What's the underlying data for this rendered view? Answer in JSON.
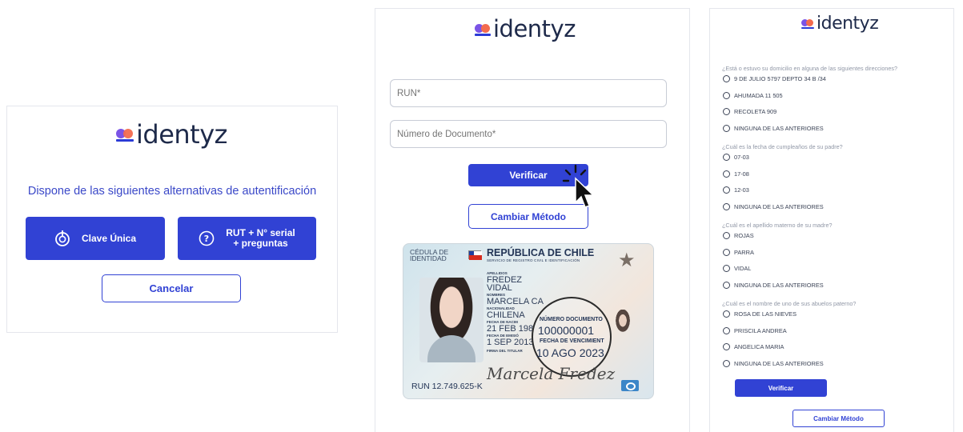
{
  "brand": {
    "name": "identyz",
    "colors": {
      "primary": "#3142d4",
      "logo_purple": "#7b54e6",
      "logo_orange": "#f36b4f",
      "text_dark": "#1e2a4a"
    }
  },
  "panel1": {
    "prompt": "Dispone de las siguientes alternativas de autentificación",
    "clave_unica_label": "Clave Única",
    "clave_unica_icon": "clave-unica-icon",
    "rut_line1": "RUT + N° serial",
    "rut_line2": "+ preguntas",
    "rut_icon": "question-circle-icon",
    "cancel_label": "Cancelar"
  },
  "panel2": {
    "run_placeholder": "RUN*",
    "doc_placeholder": "Número de Documento*",
    "verify_label": "Verificar",
    "change_method_label": "Cambiar Método",
    "id_card": {
      "header_left_1": "CÉDULA DE",
      "header_left_2": "IDENTIDAD",
      "title": "REPÚBLICA DE CHILE",
      "subtitle": "SERVICIO DE REGISTRO CIVIL E IDENTIFICACIÓN",
      "apellidos_label": "APELLIDOS",
      "apellido1": "FREDEZ",
      "apellido2": "VIDAL",
      "nombres_label": "NOMBRES",
      "nombres": "MARCELA CA",
      "nacionalidad_label": "NACIONALIDAD",
      "nacionalidad": "CHILENA",
      "fecha_nac_label": "FECHA DE NACIM",
      "fecha_nac": "21 FEB 198",
      "fecha_emision_label": "FECHA DE EMISIÓ",
      "fecha_emision": "1 SEP 2013",
      "firma_label": "FIRMA DEL TITULAR",
      "numero_documento_label": "NÚMERO DOCUMENTO",
      "numero_documento": "100000001",
      "fecha_venc_label": "FECHA DE VENCIMIENT",
      "fecha_venc": "10 AGO 2023",
      "run": "RUN 12.749.625-K",
      "signature": "Marcela Fredez"
    }
  },
  "panel3": {
    "questions": [
      {
        "text": "¿Está o estuvo su domicilio en alguna de las siguientes direcciones?",
        "options": [
          "9 DE JULIO 5797 DEPTO 34 B /34",
          "AHUMADA 11 505",
          "RECOLETA 909",
          "NINGUNA DE LAS ANTERIORES"
        ]
      },
      {
        "text": "¿Cuál es la fecha de cumpleaños de su padre?",
        "options": [
          "07-03",
          "17-08",
          "12-03",
          "NINGUNA DE LAS ANTERIORES"
        ]
      },
      {
        "text": "¿Cuál es el apellido materno de su madre?",
        "options": [
          "ROJAS",
          "PARRA",
          "VIDAL",
          "NINGUNA DE LAS ANTERIORES"
        ]
      },
      {
        "text": "¿Cuál es el nombre de uno de sus abuelos paterno?",
        "options": [
          "ROSA DE LAS NIEVES",
          "PRISCILA ANDREA",
          "ANGELICA MARIA",
          "NINGUNA DE LAS ANTERIORES"
        ]
      }
    ],
    "verify_label": "Verificar",
    "change_method_label": "Cambiar Método"
  }
}
